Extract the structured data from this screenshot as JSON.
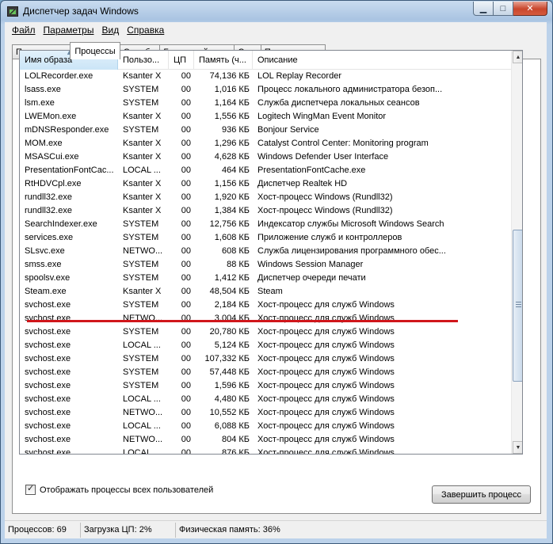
{
  "window": {
    "title": "Диспетчер задач Windows"
  },
  "menu": [
    "Файл",
    "Параметры",
    "Вид",
    "Справка"
  ],
  "tabs": [
    "Приложения",
    "Процессы",
    "Службы",
    "Быстродействие",
    "Сеть",
    "Пользователи"
  ],
  "active_tab": "Процессы",
  "columns": {
    "name": "Имя образа",
    "user": "Пользо...",
    "cpu": "ЦП",
    "memory": "Память (ч...",
    "description": "Описание"
  },
  "processes": [
    {
      "name": "LOLRecorder.exe",
      "user": "Ksanter X",
      "cpu": "00",
      "mem": "74,136 КБ",
      "desc": "LOL Replay Recorder"
    },
    {
      "name": "lsass.exe",
      "user": "SYSTEM",
      "cpu": "00",
      "mem": "1,016 КБ",
      "desc": "Процесс локального администратора безоп..."
    },
    {
      "name": "lsm.exe",
      "user": "SYSTEM",
      "cpu": "00",
      "mem": "1,164 КБ",
      "desc": "Служба диспетчера локальных сеансов"
    },
    {
      "name": "LWEMon.exe",
      "user": "Ksanter X",
      "cpu": "00",
      "mem": "1,556 КБ",
      "desc": "Logitech WingMan Event Monitor"
    },
    {
      "name": "mDNSResponder.exe",
      "user": "SYSTEM",
      "cpu": "00",
      "mem": "936 КБ",
      "desc": "Bonjour Service"
    },
    {
      "name": "MOM.exe",
      "user": "Ksanter X",
      "cpu": "00",
      "mem": "1,296 КБ",
      "desc": "Catalyst Control Center: Monitoring program"
    },
    {
      "name": "MSASCui.exe",
      "user": "Ksanter X",
      "cpu": "00",
      "mem": "4,628 КБ",
      "desc": "Windows Defender User Interface"
    },
    {
      "name": "PresentationFontCac...",
      "user": "LOCAL ...",
      "cpu": "00",
      "mem": "464 КБ",
      "desc": "PresentationFontCache.exe"
    },
    {
      "name": "RtHDVCpl.exe",
      "user": "Ksanter X",
      "cpu": "00",
      "mem": "1,156 КБ",
      "desc": "Диспетчер Realtek HD"
    },
    {
      "name": "rundll32.exe",
      "user": "Ksanter X",
      "cpu": "00",
      "mem": "1,920 КБ",
      "desc": "Хост-процесс Windows (Rundll32)"
    },
    {
      "name": "rundll32.exe",
      "user": "Ksanter X",
      "cpu": "00",
      "mem": "1,384 КБ",
      "desc": "Хост-процесс Windows (Rundll32)"
    },
    {
      "name": "SearchIndexer.exe",
      "user": "SYSTEM",
      "cpu": "00",
      "mem": "12,756 КБ",
      "desc": "Индексатор службы Microsoft Windows Search"
    },
    {
      "name": "services.exe",
      "user": "SYSTEM",
      "cpu": "00",
      "mem": "1,608 КБ",
      "desc": "Приложение служб и контроллеров"
    },
    {
      "name": "SLsvc.exe",
      "user": "NETWO...",
      "cpu": "00",
      "mem": "608 КБ",
      "desc": "Служба лицензирования программного обес..."
    },
    {
      "name": "smss.exe",
      "user": "SYSTEM",
      "cpu": "00",
      "mem": "88 КБ",
      "desc": "Windows Session Manager"
    },
    {
      "name": "spoolsv.exe",
      "user": "SYSTEM",
      "cpu": "00",
      "mem": "1,412 КБ",
      "desc": "Диспетчер очереди печати"
    },
    {
      "name": "Steam.exe",
      "user": "Ksanter X",
      "cpu": "00",
      "mem": "48,504 КБ",
      "desc": "Steam"
    },
    {
      "name": "svchost.exe",
      "user": "SYSTEM",
      "cpu": "00",
      "mem": "2,184 КБ",
      "desc": "Хост-процесс для служб Windows"
    },
    {
      "name": "svchost.exe",
      "user": "NETWO...",
      "cpu": "00",
      "mem": "3,004 КБ",
      "desc": "Хост-процесс для служб Windows"
    },
    {
      "name": "svchost.exe",
      "user": "SYSTEM",
      "cpu": "00",
      "mem": "20,780 КБ",
      "desc": "Хост-процесс для служб Windows"
    },
    {
      "name": "svchost.exe",
      "user": "LOCAL ...",
      "cpu": "00",
      "mem": "5,124 КБ",
      "desc": "Хост-процесс для служб Windows"
    },
    {
      "name": "svchost.exe",
      "user": "SYSTEM",
      "cpu": "00",
      "mem": "107,332 КБ",
      "desc": "Хост-процесс для служб Windows"
    },
    {
      "name": "svchost.exe",
      "user": "SYSTEM",
      "cpu": "00",
      "mem": "57,448 КБ",
      "desc": "Хост-процесс для служб Windows"
    },
    {
      "name": "svchost.exe",
      "user": "SYSTEM",
      "cpu": "00",
      "mem": "1,596 КБ",
      "desc": "Хост-процесс для служб Windows"
    },
    {
      "name": "svchost.exe",
      "user": "LOCAL ...",
      "cpu": "00",
      "mem": "4,480 КБ",
      "desc": "Хост-процесс для служб Windows"
    },
    {
      "name": "svchost.exe",
      "user": "NETWO...",
      "cpu": "00",
      "mem": "10,552 КБ",
      "desc": "Хост-процесс для служб Windows"
    },
    {
      "name": "svchost.exe",
      "user": "LOCAL ...",
      "cpu": "00",
      "mem": "6,088 КБ",
      "desc": "Хост-процесс для служб Windows"
    },
    {
      "name": "svchost.exe",
      "user": "NETWO...",
      "cpu": "00",
      "mem": "804 КБ",
      "desc": "Хост-процесс для служб Windows"
    },
    {
      "name": "svchost.exe",
      "user": "LOCAL ...",
      "cpu": "00",
      "mem": "876 КБ",
      "desc": "Хост-процесс для служб Windows"
    }
  ],
  "show_all_users": {
    "label": "Отображать процессы всех пользователей",
    "checked": true
  },
  "end_process_label": "Завершить процесс",
  "status": {
    "processes": "Процессов: 69",
    "cpu": "Загрузка ЦП: 2%",
    "memory": "Физическая память: 36%"
  },
  "icons": {
    "app": "task-manager-icon",
    "minimize": "minimize-icon",
    "maximize": "maximize-icon",
    "close": "close-icon"
  },
  "colors": {
    "highlight_line": "#d0161b",
    "sorted_header": "#cbe5f7"
  }
}
